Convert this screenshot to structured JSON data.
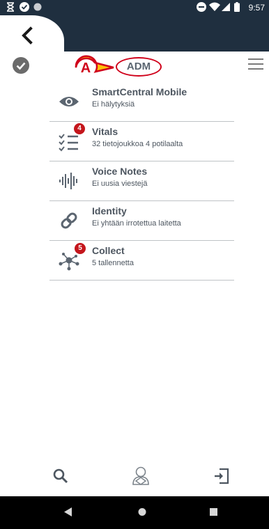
{
  "status_bar": {
    "time": "9:57",
    "left_icons": [
      "hourglass-icon",
      "check-circle-icon",
      "dot-icon"
    ],
    "right_icons": [
      "do-not-disturb-icon",
      "wifi-icon",
      "signal-icon",
      "battery-icon"
    ]
  },
  "header": {
    "back_icon": "chevron-left-icon",
    "user": "ADM",
    "callout_letter": "A"
  },
  "modules": [
    {
      "title": "SmartCentral Mobile",
      "subtitle": "Ei hälytyksiä",
      "icon": "eye-icon",
      "badge": null
    },
    {
      "title": "Vitals",
      "subtitle": "32 tietojoukkoa 4 potilaalta",
      "icon": "checklist-icon",
      "badge": "4"
    },
    {
      "title": "Voice Notes",
      "subtitle": "Ei uusia viestejä",
      "icon": "waveform-icon",
      "badge": null
    },
    {
      "title": "Identity",
      "subtitle": "Ei yhtään irrotettua laitetta",
      "icon": "link-icon",
      "badge": null
    },
    {
      "title": "Collect",
      "subtitle": "5 tallennetta",
      "icon": "network-icon",
      "badge": "5"
    }
  ],
  "toolbar": {
    "items": [
      "search-icon",
      "patient-icon",
      "login-icon"
    ]
  },
  "nav": {
    "items": [
      "back-triangle-icon",
      "home-circle-icon",
      "recents-square-icon"
    ]
  },
  "colors": {
    "header_bg": "#1f2f3f",
    "text": "#4d5660",
    "badge": "#c4161c",
    "callout": "#d0021b",
    "callout_fill": "#ffc107"
  }
}
